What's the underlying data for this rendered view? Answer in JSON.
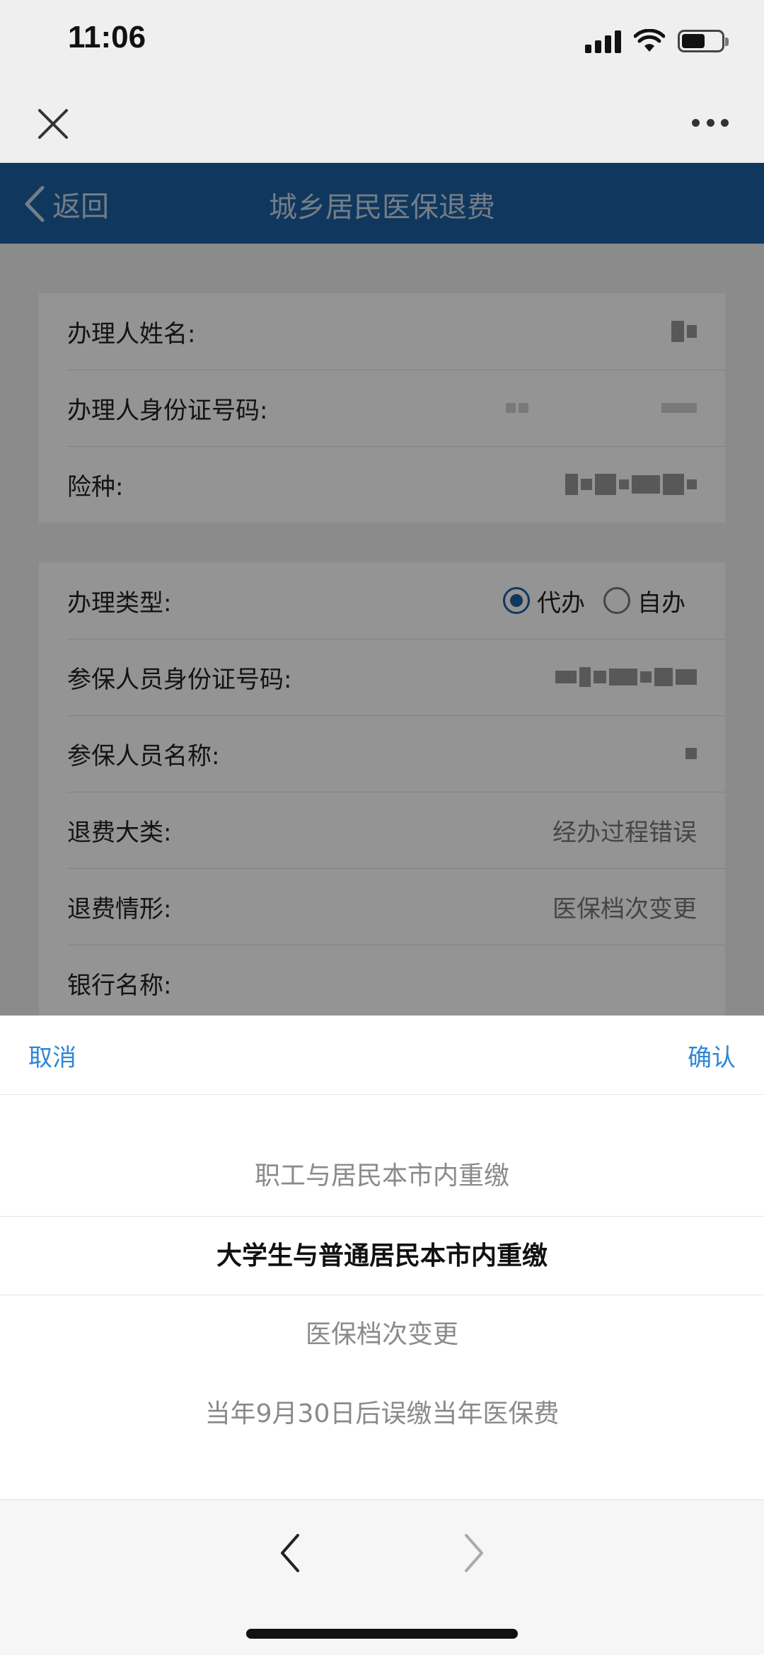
{
  "status_bar": {
    "time": "11:06"
  },
  "header": {
    "back_label": "返回",
    "title": "城乡居民医保退费"
  },
  "card1": {
    "rows": [
      {
        "label": "办理人姓名:"
      },
      {
        "label": "办理人身份证号码:"
      },
      {
        "label": "险种:"
      }
    ]
  },
  "card2": {
    "type_label": "办理类型:",
    "type_options": [
      {
        "label": "代办",
        "checked": true
      },
      {
        "label": "自办",
        "checked": false
      }
    ],
    "rows": [
      {
        "label": "参保人员身份证号码:",
        "value": ""
      },
      {
        "label": "参保人员名称:",
        "value": ""
      },
      {
        "label": "退费大类:",
        "value": "经办过程错误"
      },
      {
        "label": "退费情形:",
        "value": "医保档次变更"
      },
      {
        "label": "银行名称:",
        "value": ""
      }
    ]
  },
  "picker": {
    "cancel_label": "取消",
    "confirm_label": "确认",
    "options": [
      "职工与居民本市内重缴",
      "大学生与普通居民本市内重缴",
      "医保档次变更",
      "当年9月30日后误缴当年医保费"
    ],
    "selected_index": 1
  },
  "colors": {
    "header_bg": "#1c5fa3",
    "accent": "#2f86d6"
  }
}
